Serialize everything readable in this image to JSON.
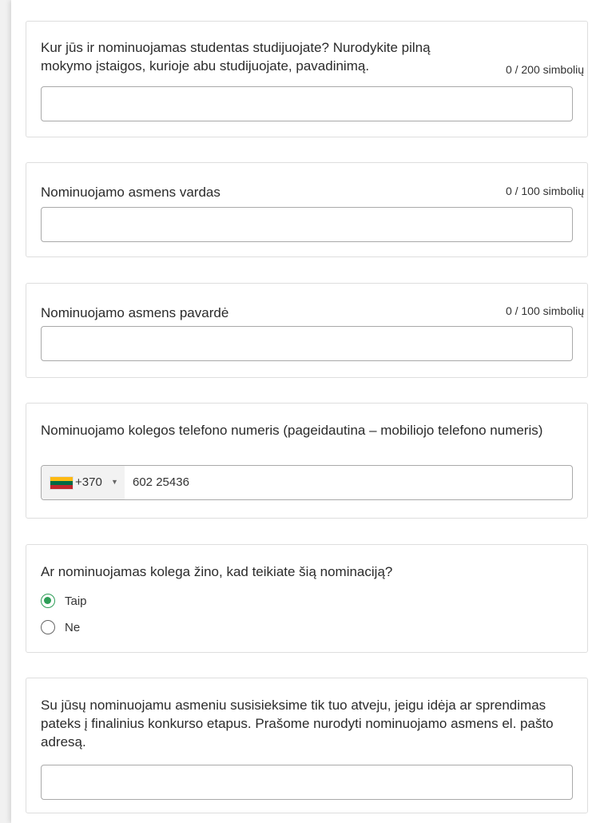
{
  "questions": {
    "study_place": {
      "label": "Kur jūs ir nominuojamas studentas studijuojate? Nurodykite pilną mokymo įstaigos, kurioje abu studijuojate, pavadinimą.",
      "counter": "0 / 200 simbolių",
      "value": ""
    },
    "first_name": {
      "label": "Nominuojamo asmens vardas",
      "counter": "0 / 100 simbolių",
      "value": ""
    },
    "last_name": {
      "label": "Nominuojamo asmens pavardė",
      "counter": "0 / 100 simbolių",
      "value": ""
    },
    "phone": {
      "label": "Nominuojamo kolegos telefono numeris (pageidautina – mobiliojo telefono numeris)",
      "country_code": "+370",
      "value": "602 25436",
      "flag_icon": "lithuania-flag-icon",
      "flag_colors": [
        "#fdb913",
        "#006a44",
        "#c1272d"
      ]
    },
    "aware": {
      "label": "Ar nominuojamas kolega žino, kad teikiate šią nominaciją?",
      "options": [
        "Taip",
        "Ne"
      ],
      "selected": "Taip",
      "accent_color": "#2e9e57"
    },
    "email": {
      "label": "Su jūsų nominuojamu asmeniu susisieksime tik tuo atveju, jeigu idėja ar sprendimas pateks į finalinius konkurso etapus. Prašome nurodyti nominuojamo asmens el. pašto adresą.",
      "value": ""
    }
  }
}
